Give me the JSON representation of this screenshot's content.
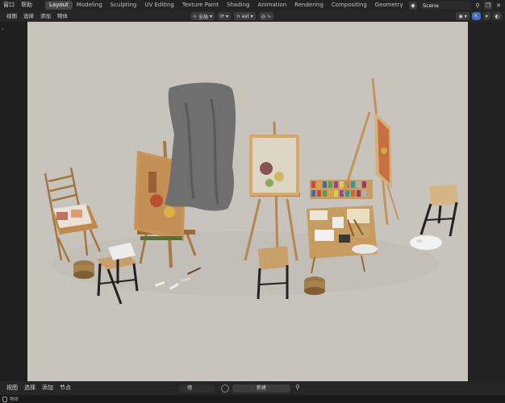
{
  "menus": {
    "window": "窗口",
    "help": "帮助"
  },
  "workspaces": [
    "Layout",
    "Modeling",
    "Sculpting",
    "UV Editing",
    "Texture Paint",
    "Shading",
    "Animation",
    "Rendering",
    "Compositing",
    "Geometry Nodes",
    "S"
  ],
  "active_workspace": "Layout",
  "scene": {
    "label": "Scene"
  },
  "viewport_menu": {
    "view": "视图",
    "select": "选择",
    "add": "添加",
    "object": "物体"
  },
  "viewport_tools": {
    "orientation": "全局",
    "snap_label": "ast"
  },
  "bottom_menu": {
    "view": "视图",
    "select": "选择",
    "add": "添加",
    "node": "节点"
  },
  "slot": {
    "label": "槽"
  },
  "new_button": {
    "label": "新建"
  },
  "status": {
    "label": "物体"
  },
  "colors": {
    "viewport_bg": "#c7c4be",
    "active_tab": "#474747",
    "accent_blue": "#3f6dbf"
  }
}
